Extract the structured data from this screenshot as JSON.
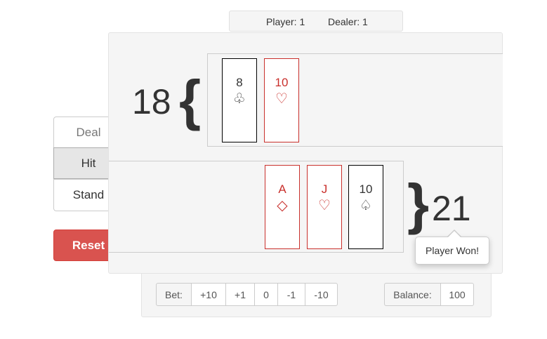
{
  "scoreboard": {
    "player_label": "Player: 1",
    "dealer_label": "Dealer: 1"
  },
  "controls": {
    "deal": "Deal",
    "hit": "Hit",
    "stand": "Stand",
    "reset": "Reset"
  },
  "dealer": {
    "score": "18",
    "cards": [
      {
        "rank": "8",
        "suit": "♧",
        "color": "black"
      },
      {
        "rank": "10",
        "suit": "♡",
        "color": "red"
      }
    ]
  },
  "player": {
    "score": "21",
    "cards": [
      {
        "rank": "A",
        "suit": "◇",
        "color": "red"
      },
      {
        "rank": "J",
        "suit": "♡",
        "color": "red"
      },
      {
        "rank": "10",
        "suit": "♤",
        "color": "black"
      }
    ]
  },
  "result": {
    "message": "Player Won!"
  },
  "betting": {
    "bet_label": "Bet:",
    "options": [
      "+10",
      "+1",
      "0",
      "-1",
      "-10"
    ],
    "balance_label": "Balance:",
    "balance_value": "100"
  },
  "colors": {
    "red_card": "#c9302c",
    "reset_button": "#d9534f",
    "panel_bg": "#f5f5f5"
  }
}
